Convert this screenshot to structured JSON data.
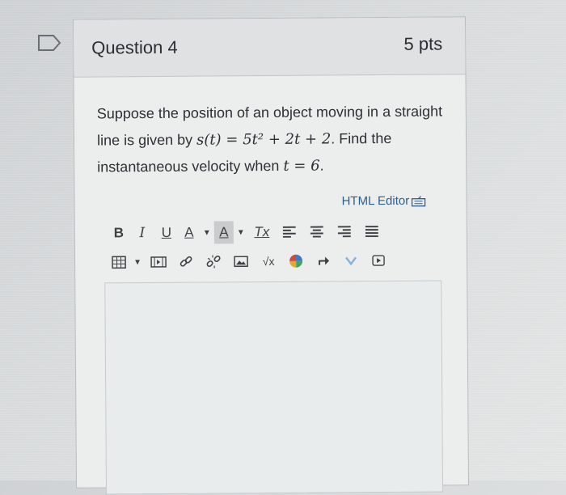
{
  "question": {
    "title": "Question 4",
    "points": "5 pts",
    "text_before": "Suppose the position of an object moving in a straight line is given by",
    "equation": "s(t) = 5t² + 2t + 2",
    "text_find": ". Find the instantaneous velocity when",
    "equation2": "t = 6",
    "text_end": "."
  },
  "editor": {
    "html_editor_label": "HTML Editor",
    "toolbar_row1": [
      {
        "name": "bold-button",
        "label": "B"
      },
      {
        "name": "italic-button",
        "label": "I"
      },
      {
        "name": "underline-button",
        "label": "U"
      },
      {
        "name": "font-color-button",
        "label": "A"
      },
      {
        "name": "background-color-button",
        "label": "A"
      },
      {
        "name": "clear-formatting-button",
        "label": "Tx"
      }
    ],
    "toolbar_row2_icons": [
      "table-icon",
      "media-icon",
      "link-icon",
      "unlink-icon",
      "image-icon",
      "math-icon",
      "color-wheel-icon",
      "arrow-icon",
      "chevron-icon",
      "video-icon"
    ],
    "math_label": "√x"
  }
}
